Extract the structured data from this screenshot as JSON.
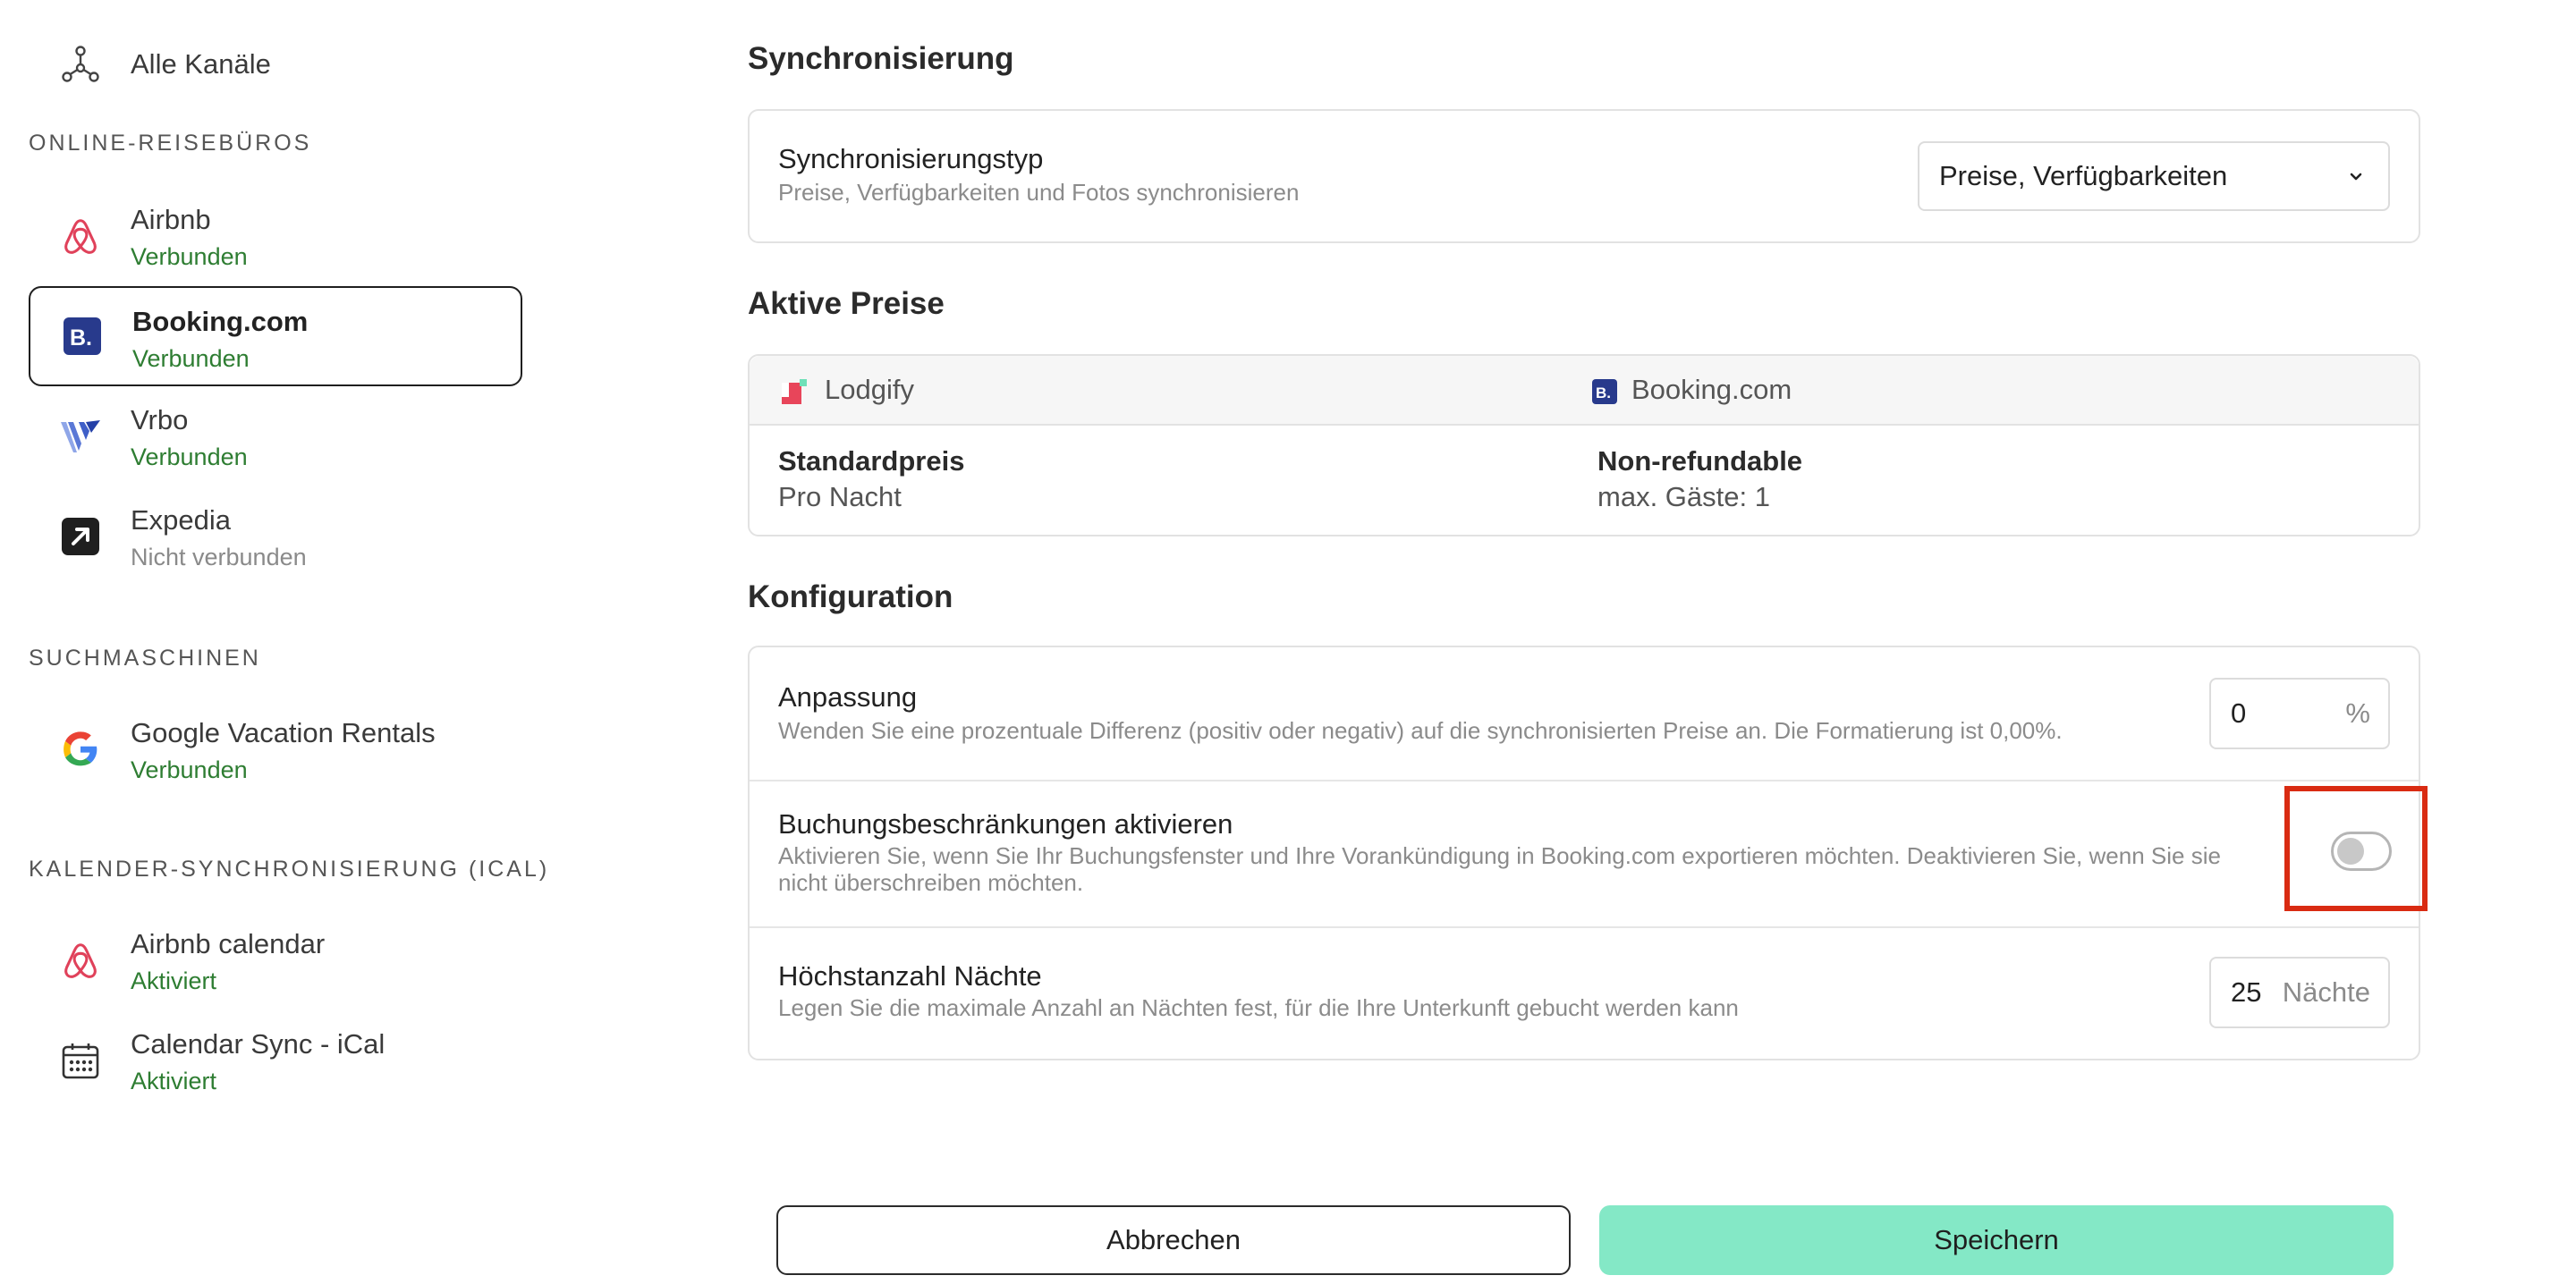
{
  "sidebar": {
    "all_channels": {
      "label": "Alle Kanäle",
      "icon": "channels-network-icon"
    },
    "sections": {
      "ota": "ONLINE-REISEBÜROS",
      "search": "SUCHMASCHINEN",
      "ical": "KALENDER-SYNCHRONISIERUNG (ICAL)"
    },
    "channels": {
      "airbnb": {
        "name": "Airbnb",
        "status": "Verbunden",
        "icon": "airbnb-icon"
      },
      "booking": {
        "name": "Booking.com",
        "status": "Verbunden",
        "icon": "booking-icon",
        "logo_letter": "B."
      },
      "vrbo": {
        "name": "Vrbo",
        "status": "Verbunden",
        "icon": "vrbo-icon"
      },
      "expedia": {
        "name": "Expedia",
        "status": "Nicht verbunden",
        "icon": "expedia-icon"
      },
      "google": {
        "name": "Google Vacation Rentals",
        "status": "Verbunden",
        "icon": "google-icon"
      },
      "airbnb_cal": {
        "name": "Airbnb calendar",
        "status": "Aktiviert",
        "icon": "airbnb-icon"
      },
      "ical": {
        "name": "Calendar Sync - iCal",
        "status": "Aktiviert",
        "icon": "calendar-icon"
      }
    }
  },
  "sync": {
    "heading": "Synchronisierung",
    "type_title": "Synchronisierungstyp",
    "type_desc": "Preise, Verfügbarkeiten und Fotos synchronisieren",
    "select_value": "Preise, Verfügbarkeiten"
  },
  "rates": {
    "heading": "Aktive Preise",
    "left_head": "Lodgify",
    "right_head": "Booking.com",
    "right_logo_letter": "B.",
    "left_title": "Standardpreis",
    "left_sub": "Pro Nacht",
    "right_title": "Non-refundable",
    "right_sub": "max. Gäste: 1"
  },
  "config": {
    "heading": "Konfiguration",
    "adjust_title": "Anpassung",
    "adjust_desc": "Wenden Sie eine prozentuale Differenz (positiv oder negativ) auf die synchronisierten Preise an. Die Formatierung ist 0,00%.",
    "adjust_value": "0",
    "adjust_suffix": "%",
    "restrict_title": "Buchungsbeschränkungen aktivieren",
    "restrict_desc": "Aktivieren Sie, wenn Sie Ihr Buchungsfenster und Ihre Vorankündigung in Booking.com exportieren möchten. Deaktivieren Sie, wenn Sie sie nicht überschreiben möchten.",
    "restrict_enabled": false,
    "max_title": "Höchstanzahl Nächte",
    "max_desc": "Legen Sie die maximale Anzahl an Nächten fest, für die Ihre Unterkunft gebucht werden kann",
    "max_value": "25",
    "max_suffix": "Nächte"
  },
  "actions": {
    "cancel": "Abbrechen",
    "save": "Speichern"
  },
  "colors": {
    "connected": "#2e7d32",
    "save_button": "#84e8c6",
    "highlight": "#d92b12",
    "airbnb": "#e0415a",
    "booking": "#283a8c"
  }
}
